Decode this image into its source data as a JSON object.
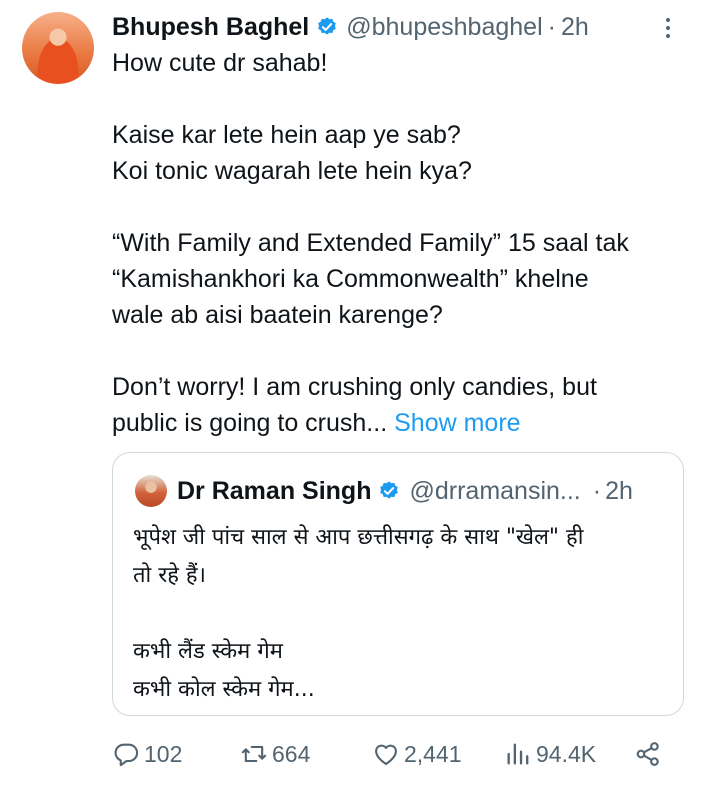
{
  "tweet": {
    "author_name": "Bhupesh Baghel",
    "handle": "@bhupeshbaghel",
    "separator": "·",
    "time": "2h",
    "lines": [
      "How cute dr sahab!",
      "",
      "Kaise kar lete hein aap ye sab?",
      "Koi tonic wagarah lete hein kya?",
      "",
      "“With Family and Extended Family” 15 saal tak",
      "“Kamishankhori ka Commonwealth” khelne",
      "wale ab aisi baatein karenge?",
      "",
      "Don’t worry! I am crushing only candies, but"
    ],
    "last_line": "public is going to crush...",
    "show_more": "Show more"
  },
  "quoted": {
    "author_name": "Dr Raman Singh",
    "handle": "@drramansin...",
    "separator": "·",
    "time": "2h",
    "lines": [
      "भूपेश जी पांच साल से आप छत्तीसगढ़ के साथ \"खेल\" ही",
      "तो रहे हैं।",
      "",
      "कभी लैंड स्केम गेम",
      "कभी कोल स्केम गेम..."
    ]
  },
  "actions": {
    "replies": "102",
    "retweets": "664",
    "likes": "2,441",
    "views": "94.4K"
  },
  "icons": {
    "verified": "verified-badge-icon",
    "more": "more-options-icon",
    "reply": "reply-icon",
    "retweet": "retweet-icon",
    "like": "heart-icon",
    "views": "views-chart-icon",
    "share": "share-icon"
  },
  "colors": {
    "accent": "#1d9bf0",
    "secondary_text": "#536471",
    "border": "#cfd9de"
  }
}
